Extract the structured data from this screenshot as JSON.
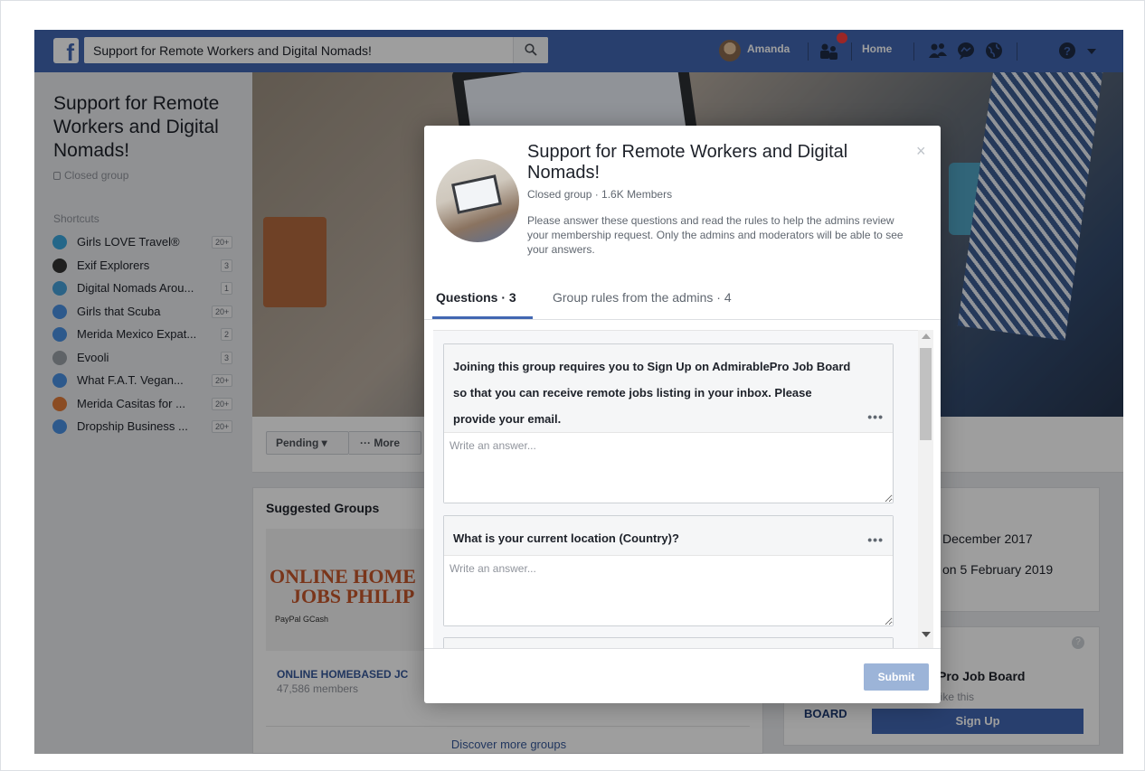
{
  "topbar": {
    "search_value": "Support for Remote Workers and Digital Nomads!",
    "user_name": "Amanda",
    "home_label": "Home"
  },
  "sidebar": {
    "group_title": "Support for Remote Workers and Digital Nomads!",
    "group_type": "Closed group",
    "shortcuts_heading": "Shortcuts",
    "shortcuts": [
      {
        "label": "Girls LOVE Travel®",
        "badge": "20+",
        "icon": "globe-icon",
        "color": "#3aa6dd"
      },
      {
        "label": "Exif Explorers",
        "badge": "3",
        "icon": "camera-icon",
        "color": "#333333"
      },
      {
        "label": "Digital Nomads Arou...",
        "badge": "1",
        "icon": "globe-icon",
        "color": "#46a0d8"
      },
      {
        "label": "Girls that Scuba",
        "badge": "20+",
        "icon": "group-icon",
        "color": "#4a90e2"
      },
      {
        "label": "Merida Mexico Expat...",
        "badge": "2",
        "icon": "group-icon",
        "color": "#4a90e2"
      },
      {
        "label": "Evooli",
        "badge": "3",
        "icon": "leaf-icon",
        "color": "#9aa0a6"
      },
      {
        "label": "What F.A.T. Vegan...",
        "badge": "20+",
        "icon": "group-icon",
        "color": "#4a90e2"
      },
      {
        "label": "Merida Casitas for ...",
        "badge": "20+",
        "icon": "house-icon",
        "color": "#e07b39"
      },
      {
        "label": "Dropship Business ...",
        "badge": "20+",
        "icon": "group-icon",
        "color": "#4a90e2"
      }
    ]
  },
  "actions": {
    "pending_label": "Pending ▾",
    "more_label": "··· More"
  },
  "suggested": {
    "heading": "Suggested Groups",
    "image_line1": "ONLINE HOME",
    "image_line2": "JOBS PHILIP",
    "image_logos": "PayPal  GCash",
    "group_name": "ONLINE HOMEBASED JC",
    "group_members": "47,586 members",
    "discover_label": "Discover more groups"
  },
  "about": {
    "line1": "December 2017",
    "line2": "on 5 February 2019"
  },
  "ad": {
    "title": "Pro Job Board",
    "subtitle": "like this",
    "board_label": "BOARD",
    "signup_label": "Sign Up",
    "info_label": "?"
  },
  "modal": {
    "title": "Support for Remote Workers and Digital Nomads!",
    "meta": "Closed group · 1.6K Members",
    "description": "Please answer these questions and read the rules to help the admins review your membership request. Only the admins and moderators will be able to see your answers.",
    "close_label": "×",
    "tab_questions": "Questions · 3",
    "tab_rules": "Group rules from the admins · 4",
    "questions": [
      {
        "text": "Joining this group requires you to Sign Up on AdmirablePro Job Board so that you can receive remote jobs listing in your inbox. Please provide your email.",
        "placeholder": "Write an answer..."
      },
      {
        "text": "What is your current location (Country)?",
        "placeholder": "Write an answer..."
      }
    ],
    "question_menu": "•••",
    "submit_label": "Submit"
  },
  "colors": {
    "brand": "#4267b2",
    "submit_disabled": "#9cb4d8",
    "notification": "#fa3e3e"
  }
}
